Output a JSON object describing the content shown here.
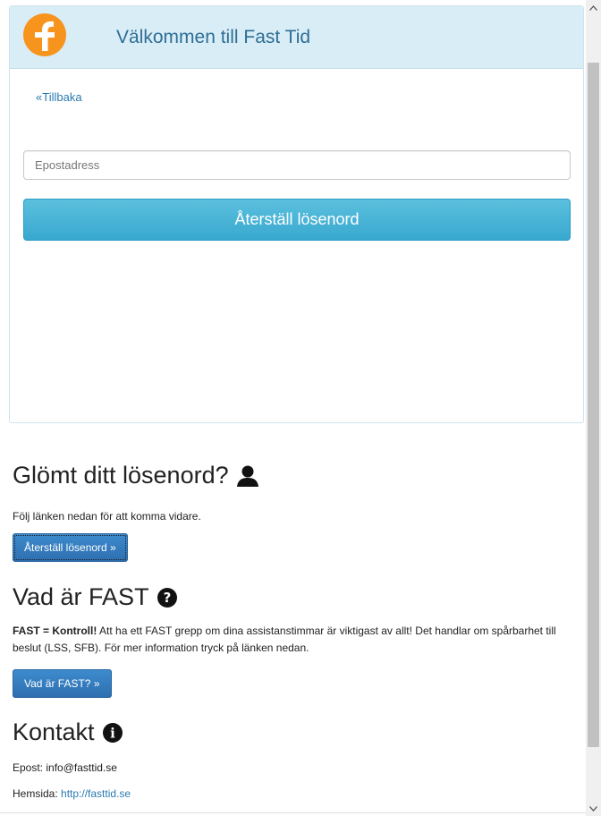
{
  "panel": {
    "title": "Välkommen till Fast Tid",
    "back_link": "«Tillbaka",
    "email_placeholder": "Epostadress",
    "reset_button": "Återställ lösenord"
  },
  "forgot": {
    "heading": "Glömt ditt lösenord?",
    "text": "Följ länken nedan för att komma vidare.",
    "button": "Återställ lösenord »"
  },
  "about": {
    "heading": "Vad är FAST",
    "text_bold": "FAST = Kontroll!",
    "text_rest": " Att ha ett FAST grepp om dina assistanstimmar är viktigast av allt! Det handlar om spårbarhet till beslut (LSS, SFB). För mer information tryck på länken nedan.",
    "button": "Vad är FAST? »"
  },
  "contact": {
    "heading": "Kontakt",
    "email_label": "Epost: ",
    "email_value": "info@fasttid.se",
    "site_label": "Hemsida: ",
    "site_value": "http://fasttid.se"
  },
  "icons": {
    "logo": "fast-tid-logo-icon",
    "user": "user-icon",
    "question": "question-circle-icon",
    "info": "info-circle-icon"
  },
  "colors": {
    "header_bg": "#d9edf7",
    "title_text": "#2f6e94",
    "primary_button": "#5bc0de",
    "secondary_button": "#3d8bcd",
    "logo_orange": "#f7941d"
  }
}
